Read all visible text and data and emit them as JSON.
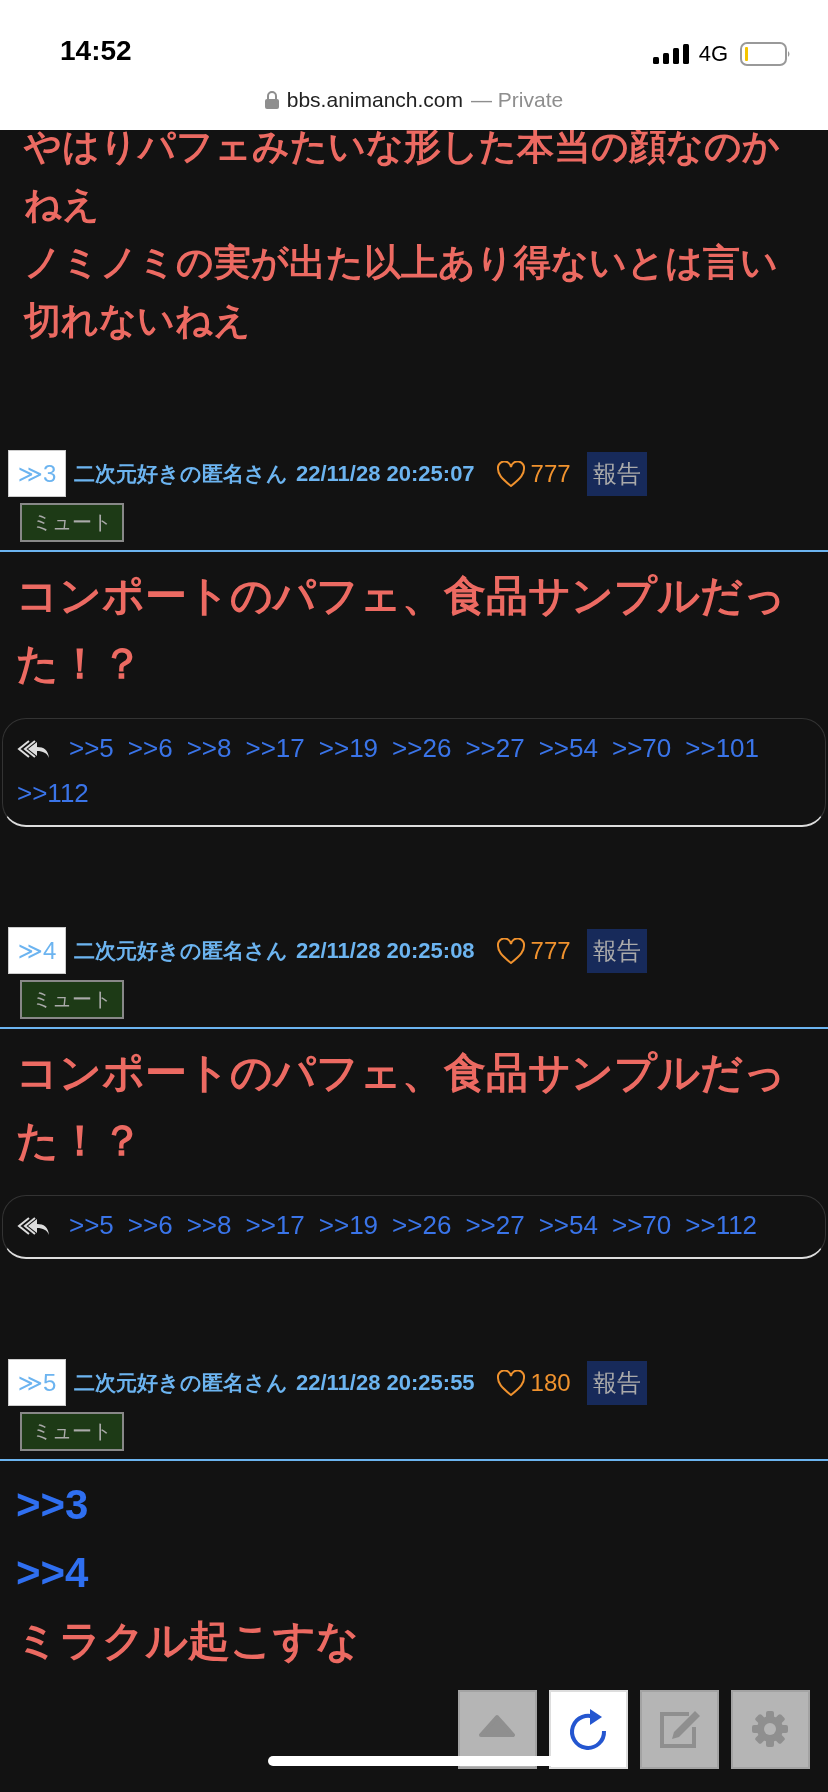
{
  "status_bar": {
    "time": "14:52",
    "network": "4G"
  },
  "browser": {
    "url": "bbs.animanch.com",
    "mode": "— Private"
  },
  "posts": [
    {
      "kind": "partial",
      "lines": [
        {
          "kind": "text",
          "text": "やはりパフェみたいな形した本当の顔なのか"
        },
        {
          "kind": "text",
          "text": "ねえ"
        },
        {
          "kind": "text",
          "text": "ノミノミの実が出た以上あり得ないとは言い"
        },
        {
          "kind": "text",
          "text": "切れないねえ"
        }
      ]
    },
    {
      "kind": "full",
      "number": "≫3",
      "author": "二次元好きの匿名さん",
      "date": "22/11/28 20:25:07",
      "likes": "777",
      "report": "報告",
      "mute": "ミュート",
      "lines": [
        {
          "kind": "text",
          "text": "コンポートのパフェ、食品サンプルだっ"
        },
        {
          "kind": "text",
          "text": "た！？"
        }
      ],
      "replies": [
        ">>5",
        ">>6",
        ">>8",
        ">>17",
        ">>19",
        ">>26",
        ">>27",
        ">>54",
        ">>70",
        ">>101",
        ">>112"
      ]
    },
    {
      "kind": "full",
      "number": "≫4",
      "author": "二次元好きの匿名さん",
      "date": "22/11/28 20:25:08",
      "likes": "777",
      "report": "報告",
      "mute": "ミュート",
      "lines": [
        {
          "kind": "text",
          "text": "コンポートのパフェ、食品サンプルだっ"
        },
        {
          "kind": "text",
          "text": "た！？"
        }
      ],
      "replies": [
        ">>5",
        ">>6",
        ">>8",
        ">>17",
        ">>19",
        ">>26",
        ">>27",
        ">>54",
        ">>70",
        ">>112"
      ]
    },
    {
      "kind": "full",
      "number": "≫5",
      "author": "二次元好きの匿名さん",
      "date": "22/11/28 20:25:55",
      "likes": "180",
      "report": "報告",
      "mute": "ミュート",
      "lines": [
        {
          "kind": "link",
          "text": ">>3"
        },
        {
          "kind": "link",
          "text": ">>4"
        },
        {
          "kind": "text",
          "text": "ミラクル起こすな"
        }
      ]
    }
  ],
  "toolbar": [
    {
      "kind": "up",
      "active": false
    },
    {
      "kind": "reload",
      "active": true
    },
    {
      "kind": "edit",
      "active": false
    },
    {
      "kind": "settings",
      "active": false
    }
  ]
}
